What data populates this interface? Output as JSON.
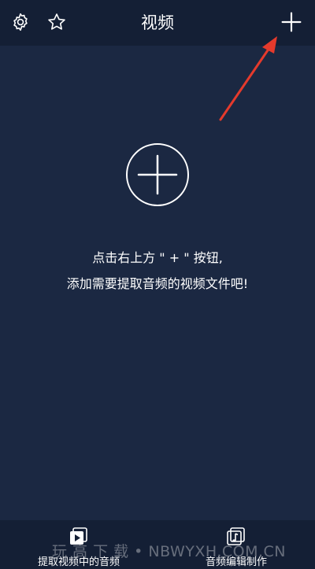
{
  "header": {
    "title": "视频",
    "icons": {
      "settings": "gear-icon",
      "favorite": "star-icon",
      "add": "plus-icon"
    }
  },
  "main": {
    "hint_line_1": "点击右上方 \" + \" 按钮,",
    "hint_line_2": "添加需要提取音频的视频文件吧!"
  },
  "bottom_nav": {
    "items": [
      {
        "label": "提取视频中的音频",
        "icon": "video-play-icon"
      },
      {
        "label": "音频编辑制作",
        "icon": "music-note-icon"
      }
    ]
  },
  "watermark": "玩 高 下 载 • NBWYXH.COM.CN",
  "colors": {
    "background": "#1b2842",
    "bar": "#141f35",
    "arrow": "#e53a2c",
    "text": "#ffffff"
  }
}
